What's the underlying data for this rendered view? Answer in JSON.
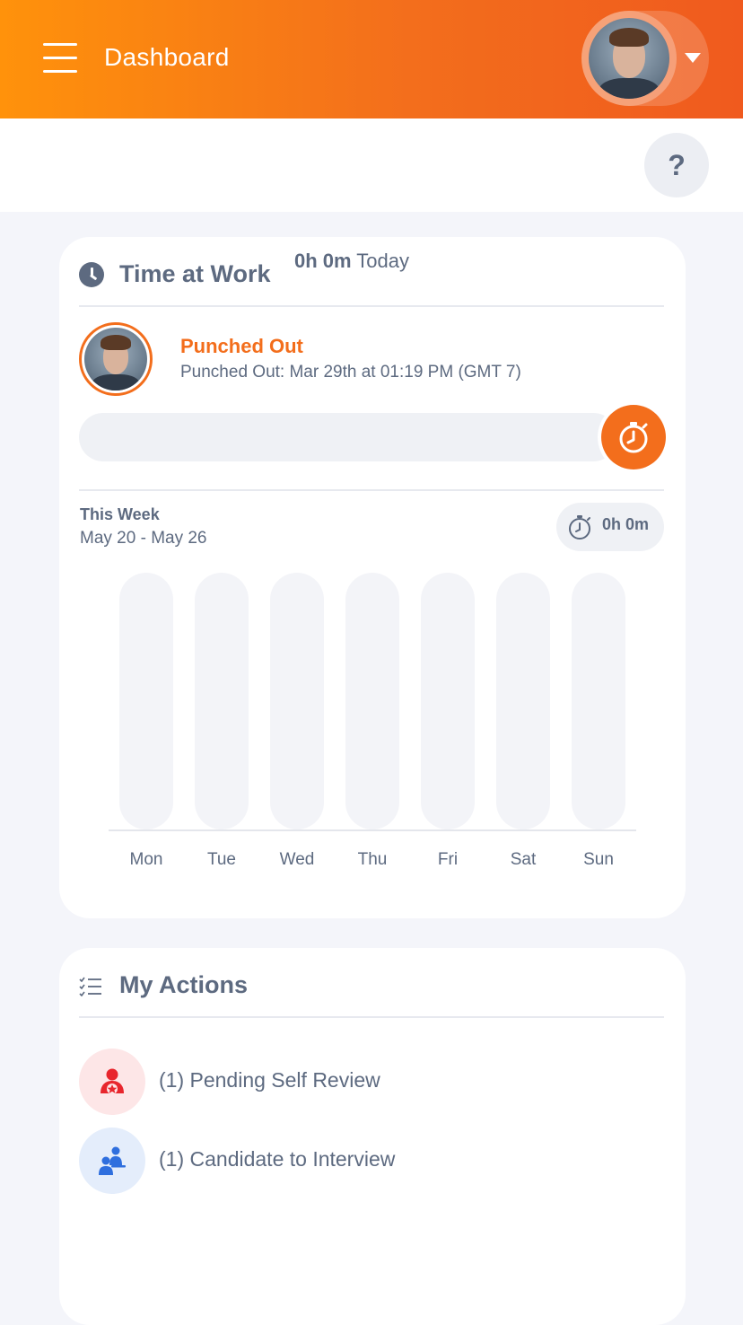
{
  "header": {
    "title": "Dashboard",
    "menu_icon": "hamburger-icon",
    "dropdown_icon": "caret-down-icon"
  },
  "help": {
    "label": "?"
  },
  "time_at_work": {
    "title": "Time at Work",
    "status": "Punched Out",
    "last_punch": "Punched Out: Mar 29th at 01:19 PM (GMT 7)",
    "today_total": "0h 0m",
    "today_label": "Today",
    "week": {
      "title": "This Week",
      "range": "May 20 - May 26",
      "total": "0h 0m"
    }
  },
  "chart_data": {
    "type": "bar",
    "categories": [
      "Mon",
      "Tue",
      "Wed",
      "Thu",
      "Fri",
      "Sat",
      "Sun"
    ],
    "values": [
      0,
      0,
      0,
      0,
      0,
      0,
      0
    ]
  },
  "my_actions": {
    "title": "My Actions",
    "items": [
      {
        "label": "(1) Pending Self Review",
        "icon": "self-review-icon",
        "color": "#e8262d",
        "bg": "#fde6e7"
      },
      {
        "label": "(1) Candidate to Interview",
        "icon": "interview-icon",
        "color": "#2f6fde",
        "bg": "#e4edfb"
      }
    ]
  },
  "colors": {
    "accent": "#f36e1c",
    "text": "#5d6a80"
  }
}
